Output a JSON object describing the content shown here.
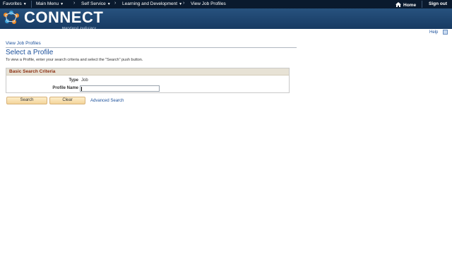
{
  "nav": {
    "favorites": "Favorites",
    "main_menu": "Main Menu",
    "self_service": "Self Service",
    "learning": "Learning and Development",
    "current": "View Job Profiles",
    "home": "Home",
    "sign_out": "Sign out"
  },
  "banner": {
    "logo_text": "CONNECT",
    "logo_sub": "Maryland Judiciary",
    "colors": {
      "top_bar": "#0a1a2e",
      "banner": "#1f4670",
      "link": "#1a4f9a"
    }
  },
  "help": {
    "label": "Help"
  },
  "page": {
    "breadcrumb": "View Job Profiles",
    "title": "Select a Profile",
    "instructions": "To view a Profile, enter your search criteria and select the \"Search\" push button."
  },
  "search": {
    "section_title": "Basic Search Criteria",
    "type_label": "Type",
    "type_value": "Job",
    "profile_name_label": "Profile Name",
    "profile_name_value": ""
  },
  "actions": {
    "search": "Search",
    "clear": "Clear",
    "advanced": "Advanced Search"
  }
}
